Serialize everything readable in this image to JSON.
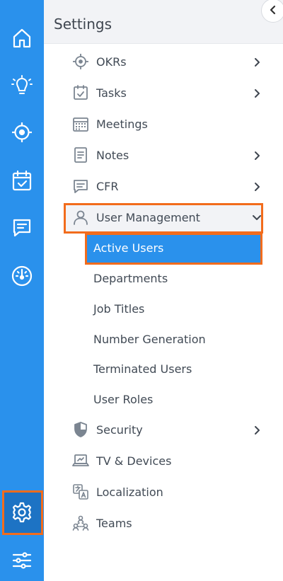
{
  "sidebar": {
    "rail_icons": [
      "home-icon",
      "lightbulb-icon",
      "target-icon",
      "calendar-check-icon",
      "chat-icon",
      "gauge-icon",
      "gear-icon",
      "sliders-icon"
    ],
    "accent_color": "#2a91ec",
    "highlight_color": "#f26c1c"
  },
  "panel": {
    "title": "Settings",
    "collapse_icon": "chevron-left-icon"
  },
  "menu": {
    "okrs": "OKRs",
    "tasks": "Tasks",
    "meetings": "Meetings",
    "notes": "Notes",
    "cfr": "CFR",
    "user_management": "User Management",
    "user_management_sub": {
      "active_users": "Active Users",
      "departments": "Departments",
      "job_titles": "Job Titles",
      "number_generation": "Number Generation",
      "terminated_users": "Terminated Users",
      "user_roles": "User Roles"
    },
    "security": "Security",
    "tv_devices": "TV & Devices",
    "localization": "Localization",
    "teams": "Teams"
  }
}
